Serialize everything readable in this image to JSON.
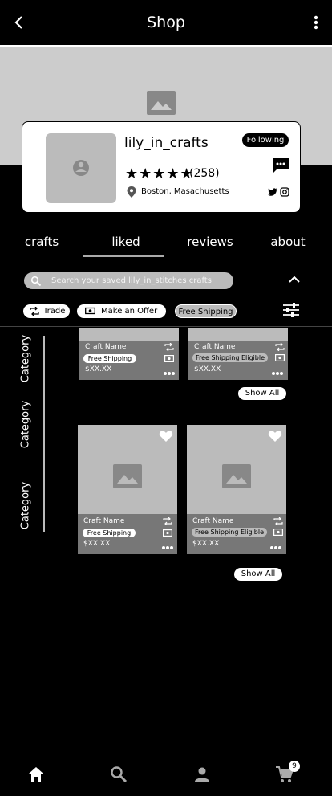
{
  "header": {
    "title": "Shop",
    "back_icon": "chevron-left-icon",
    "menu_icon": "more-vertical-icon"
  },
  "profile": {
    "username": "lily_in_crafts",
    "stars": "★★★★★",
    "rating_count": "(258)",
    "location": "Boston, Masachusetts",
    "follow_label": "Following",
    "icons": [
      "location-pin-icon",
      "chat-icon",
      "twitter-icon",
      "instagram-icon"
    ]
  },
  "tabs": [
    {
      "label": "crafts",
      "active": false
    },
    {
      "label": "liked",
      "active": true
    },
    {
      "label": "reviews",
      "active": false
    },
    {
      "label": "about",
      "active": false
    }
  ],
  "search": {
    "placeholder": "Search your saved lily_in_stitches crafts"
  },
  "filters": {
    "trade_label": "Trade",
    "offer_label": "Make an Offer",
    "shipping_label": "Free Shipping"
  },
  "categories": [
    "Category",
    "Category",
    "Category"
  ],
  "rows": [
    {
      "items": [
        {
          "name": "Craft Name",
          "badge": "Free Shipping",
          "price": "$XX.XX"
        },
        {
          "name": "Craft Name",
          "badge": "Free Shipping Eligible",
          "price": "$XX.XX"
        }
      ],
      "show_all": "Show All"
    },
    {
      "items": [
        {
          "name": "Craft Name",
          "badge": "Free Shipping",
          "price": "$XX.XX",
          "liked": true
        },
        {
          "name": "Craft Name",
          "badge": "Free Shipping Eligible",
          "price": "$XX.XX",
          "liked": true
        }
      ],
      "show_all": "Show All"
    }
  ],
  "bottom_nav": {
    "items": [
      "home-icon",
      "search-icon",
      "profile-icon",
      "cart-icon"
    ],
    "cart_count": "9"
  },
  "colors": {
    "background": "#000000",
    "card": "#ffffff",
    "placeholder": "#bbbbbb",
    "card_footer": "#777777"
  }
}
